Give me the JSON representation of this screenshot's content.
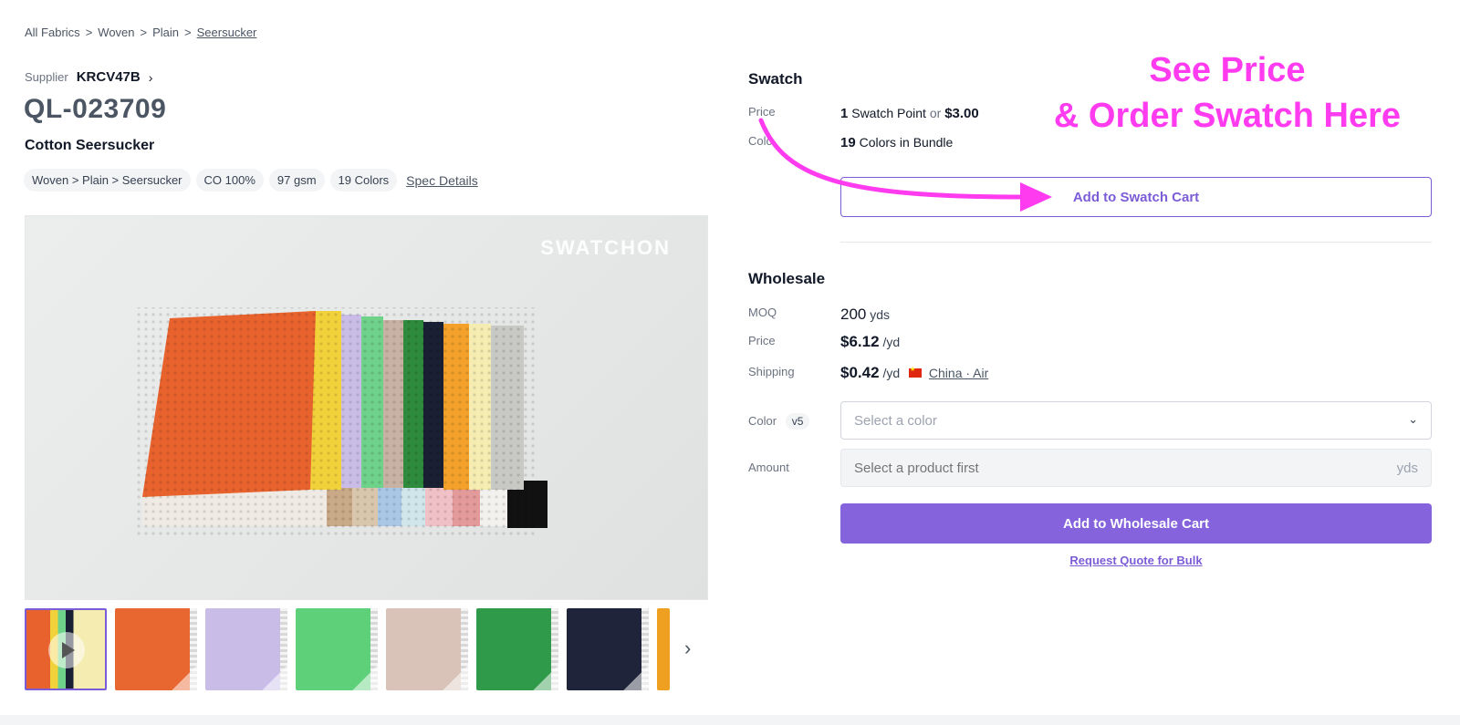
{
  "breadcrumb": {
    "items": [
      "All Fabrics",
      "Woven",
      "Plain"
    ],
    "sep": ">",
    "current": "Seersucker"
  },
  "supplier": {
    "label": "Supplier",
    "name": "KRCV47B",
    "chevron": "›"
  },
  "product": {
    "code": "QL-023709",
    "name": "Cotton Seersucker"
  },
  "tags": [
    "Woven > Plain > Seersucker",
    "CO 100%",
    "97 gsm",
    "19 Colors"
  ],
  "spec_link": "Spec Details",
  "image": {
    "watermark": "SWATCHON"
  },
  "thumbnails": [
    {
      "color": "#e9e4dc",
      "kind": "video"
    },
    {
      "color": "#e8662f",
      "kind": "fabric"
    },
    {
      "color": "#c9bde8",
      "kind": "fabric"
    },
    {
      "color": "#5ed07a",
      "kind": "fabric"
    },
    {
      "color": "#d9c3b8",
      "kind": "fabric"
    },
    {
      "color": "#2f9a4a",
      "kind": "fabric"
    },
    {
      "color": "#20243a",
      "kind": "fabric"
    },
    {
      "color": "#f0a020",
      "kind": "fabric"
    }
  ],
  "thumb_nav": "›",
  "swatch": {
    "title": "Swatch",
    "price_label": "Price",
    "price_points": "1",
    "price_points_unit": "Swatch Point",
    "or": "or",
    "price_usd": "$3.00",
    "color_label": "Colo",
    "colors_count": "19",
    "colors_text": "Colors in Bundle",
    "add_button": "Add to Swatch Cart"
  },
  "wholesale": {
    "title": "Wholesale",
    "moq_label": "MOQ",
    "moq_value": "200",
    "moq_unit": "yds",
    "price_label": "Price",
    "price_value": "$6.12",
    "price_unit": "/yd",
    "shipping_label": "Shipping",
    "shipping_value": "$0.42",
    "shipping_unit": "/yd",
    "shipping_origin": "China · Air",
    "color_label": "Color",
    "color_badge": "v5",
    "color_placeholder": "Select a color",
    "amount_label": "Amount",
    "amount_placeholder": "Select a product first",
    "amount_unit": "yds",
    "add_button": "Add to Wholesale Cart",
    "quote_link": "Request Quote for Bulk"
  },
  "annotation": {
    "line1": "See Price",
    "line2": "& Order Swatch Here",
    "color": "#ff3bf0"
  },
  "colors": {
    "accent": "#7c5cd6",
    "primary_button": "#8463dc"
  }
}
